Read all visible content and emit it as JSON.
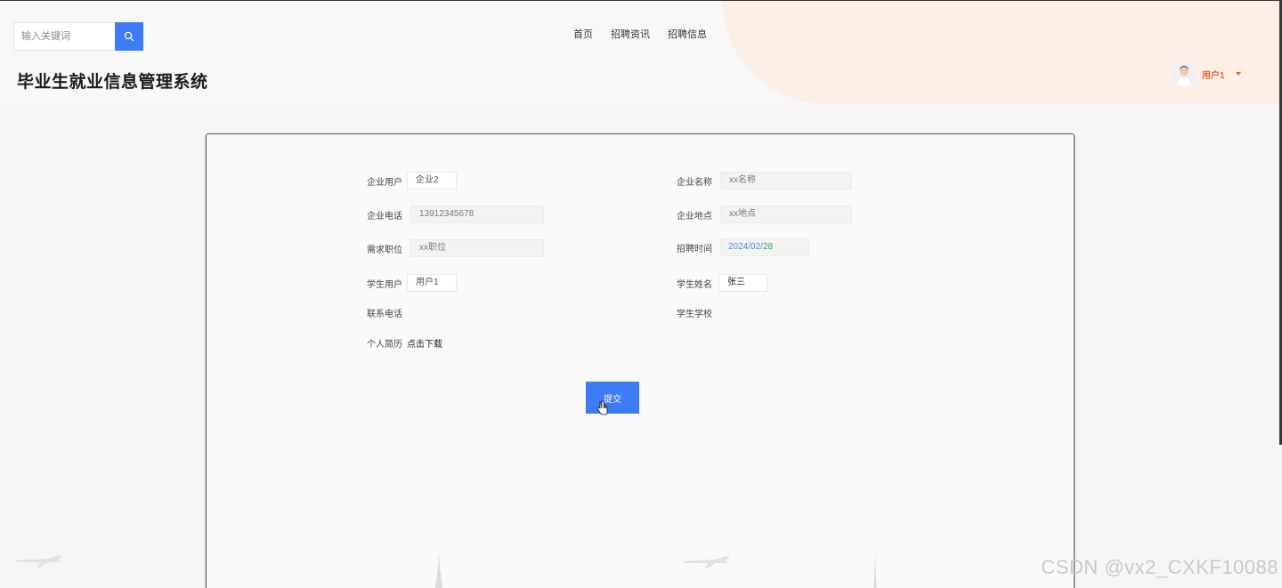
{
  "search": {
    "placeholder": "输入关键词"
  },
  "nav": {
    "items": [
      "首页",
      "招聘资讯",
      "招聘信息"
    ]
  },
  "site": {
    "title": "毕业生就业信息管理系统"
  },
  "user": {
    "name": "用户1"
  },
  "form": {
    "company_account_label": "企业用户",
    "company_account_value": "企业2",
    "company_name_label": "企业名称",
    "company_name_value": "xx名称",
    "company_phone_label": "企业电话",
    "company_phone_value": "13912345678",
    "company_address_label": "企业地点",
    "company_address_value": "xx地点",
    "position_label": "需求职位",
    "position_value": "xx职位",
    "recruit_time_label": "招聘时间",
    "recruit_time_year": "2024",
    "recruit_time_month": "02",
    "recruit_time_day": "28",
    "student_account_label": "学生用户",
    "student_account_value": "用户1",
    "student_name_label": "学生姓名",
    "student_name_value": "张三",
    "contact_phone_label": "联系电话",
    "school_label": "学生学校",
    "resume_label": "个人简历",
    "resume_link": "点击下载",
    "submit_label": "提交"
  },
  "watermark": "CSDN @vx2_CXKF10088",
  "icons": {
    "search": "search-icon",
    "caret": "caret-down-icon",
    "cursor": "hand-cursor-icon"
  },
  "colors": {
    "primary": "#3d7bf7",
    "accent": "#e0662b",
    "header_blob": "#fdeee6"
  }
}
